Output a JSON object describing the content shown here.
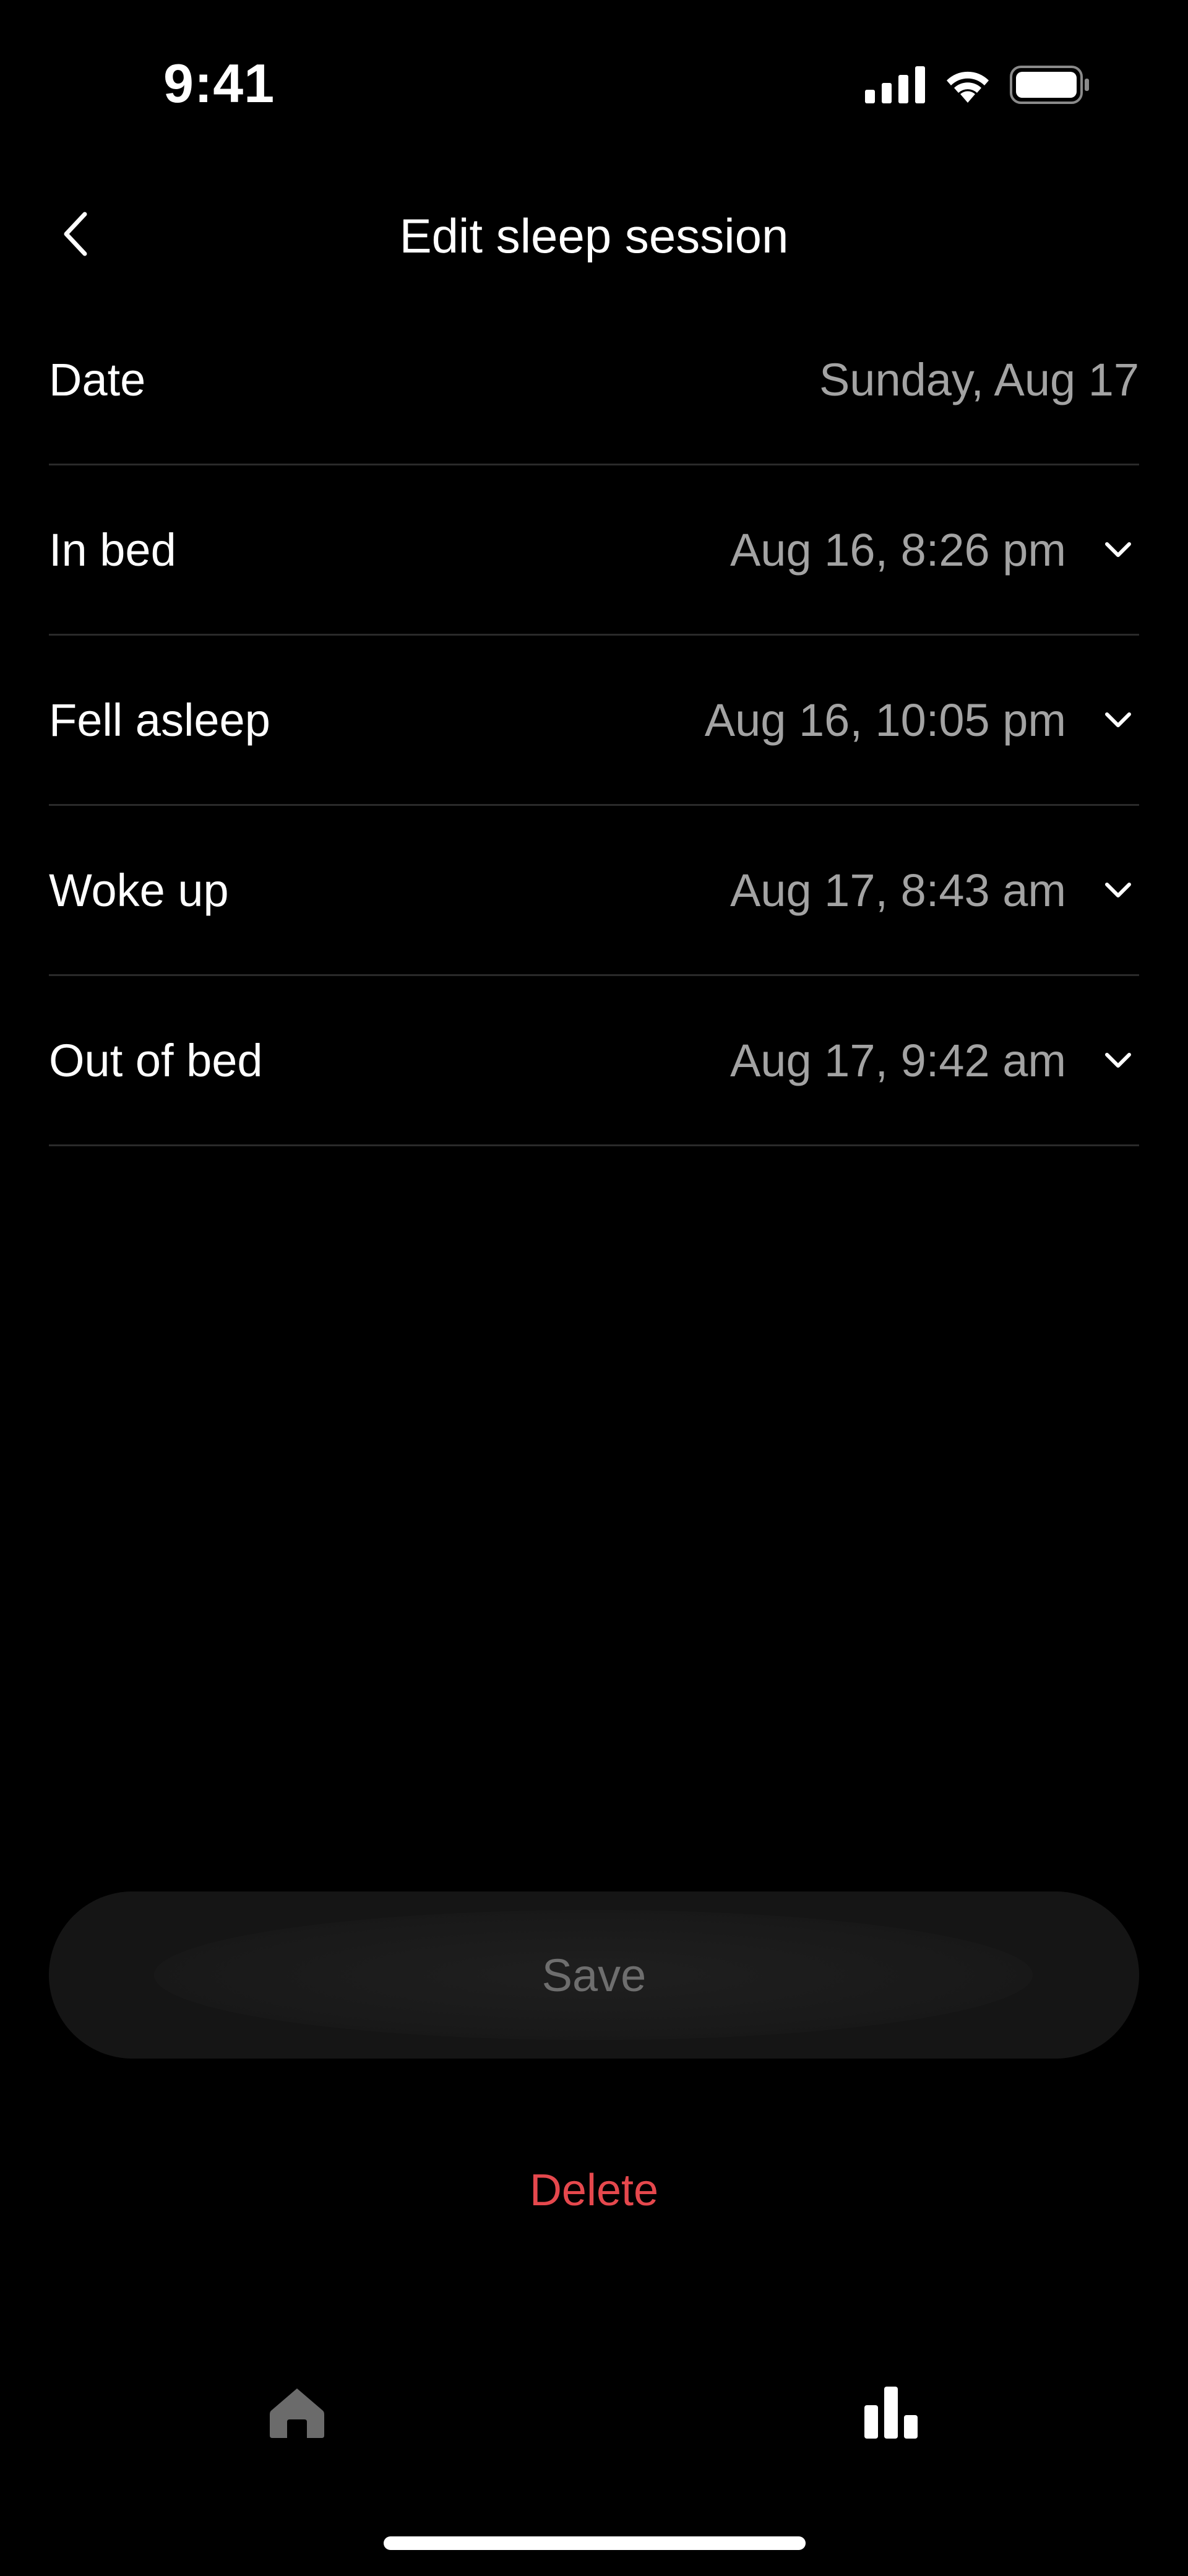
{
  "status_bar": {
    "time": "9:41",
    "icons": [
      "cellular-signal-icon",
      "wifi-icon",
      "battery-icon"
    ]
  },
  "header": {
    "title": "Edit sleep session",
    "back_icon": "chevron-left-icon"
  },
  "rows": [
    {
      "label": "Date",
      "value": "Sunday, Aug 17"
    },
    {
      "label": "In bed",
      "value": "Aug 16, 8:26 pm"
    },
    {
      "label": "Fell asleep",
      "value": "Aug 16, 10:05 pm"
    },
    {
      "label": "Woke up",
      "value": "Aug 17, 8:43 am"
    },
    {
      "label": "Out of bed",
      "value": "Aug 17, 9:42 am"
    }
  ],
  "actions": {
    "save_label": "Save",
    "delete_label": "Delete"
  },
  "tab_bar": {
    "tabs": [
      {
        "icon": "home-icon",
        "active": false
      },
      {
        "icon": "bar-chart-icon",
        "active": true
      }
    ]
  },
  "colors": {
    "background": "#000000",
    "text_primary": "#ffffff",
    "text_secondary": "#a3a3a3",
    "divider": "#2a2a2a",
    "save_bg": "#151515",
    "save_text_disabled": "#6e6e6e",
    "delete": "#e5484d",
    "tab_inactive": "#6b6b6b",
    "tab_active": "#ffffff"
  }
}
